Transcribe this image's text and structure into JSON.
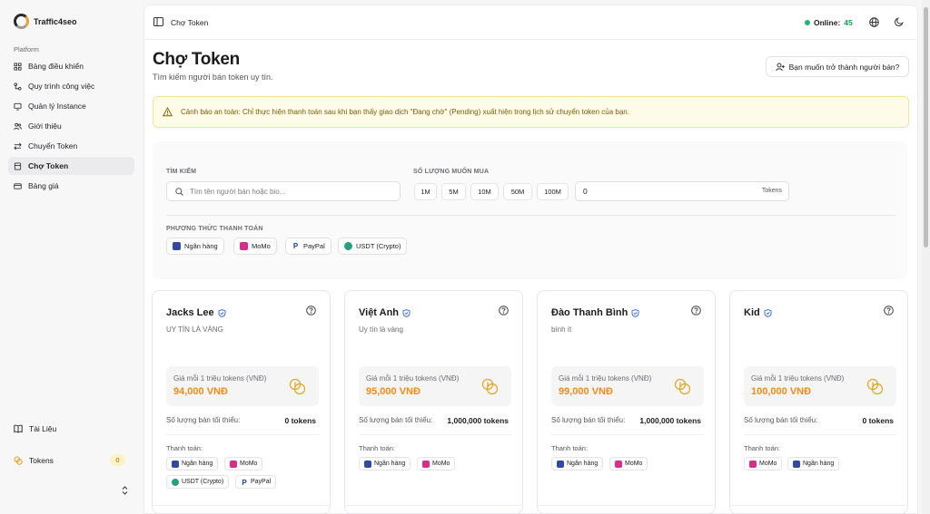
{
  "app": {
    "brand": "Traffic4seo"
  },
  "sidebar": {
    "group_label": "Platform",
    "items": [
      {
        "label": "Bảng điều khiển",
        "icon": "dashboard-icon"
      },
      {
        "label": "Quy trình công việc",
        "icon": "workflow-icon"
      },
      {
        "label": "Quản lý Instance",
        "icon": "monitor-icon"
      },
      {
        "label": "Giới thiệu",
        "icon": "users-icon"
      },
      {
        "label": "Chuyển Token",
        "icon": "transfer-icon"
      },
      {
        "label": "Chợ Token",
        "icon": "market-icon",
        "active": true
      },
      {
        "label": "Bảng giá",
        "icon": "card-icon"
      }
    ],
    "docs_label": "Tài Liệu",
    "tokens_label": "Tokens",
    "tokens_count": "0"
  },
  "topbar": {
    "breadcrumb": "Chợ Token",
    "online_label": "Online:",
    "online_count": "45"
  },
  "page": {
    "title": "Chợ Token",
    "subtitle": "Tìm kiếm người bán token uy tín.",
    "seller_button": "Bạn muốn trở thành người bán?"
  },
  "alert": {
    "text": "Cảnh báo an toàn: Chỉ thực hiện thanh toán sau khi bạn thấy giao dịch \"Đang chờ\" (Pending) xuất hiện trong lịch sử chuyển token của bạn."
  },
  "filters": {
    "search_label": "TÌM KIẾM",
    "search_placeholder": "Tìm tên người bán hoặc bio...",
    "quantity_label": "SỐ LƯỢNG MUỐN MUA",
    "quantity_options": [
      "1M",
      "5M",
      "10M",
      "50M",
      "100M"
    ],
    "quantity_value": "0",
    "quantity_unit": "Tokens",
    "payment_label": "PHƯƠNG THỨC THANH TOÁN",
    "payment_methods": [
      "Ngân hàng",
      "MoMo",
      "PayPal",
      "USDT (Crypto)"
    ]
  },
  "card_labels": {
    "price_label": "Giá mỗi 1 triệu tokens (VNĐ)",
    "min_label": "Số lượng bán tối thiểu:",
    "payment_title": "Thanh toán:"
  },
  "sellers": [
    {
      "name": "Jacks Lee",
      "bio": "UY TÍN LÀ VÀNG",
      "price": "94,000 VNĐ",
      "min": "0 tokens",
      "payments": [
        "Ngân hàng",
        "MoMo",
        "USDT (Crypto)",
        "PayPal"
      ]
    },
    {
      "name": "Việt Anh",
      "bio": "Uy tín là vàng",
      "price": "95,000 VNĐ",
      "min": "1,000,000 tokens",
      "payments": [
        "Ngân hàng",
        "MoMo"
      ]
    },
    {
      "name": "Đào Thanh Bình",
      "bio": "bình ít",
      "price": "99,000 VNĐ",
      "min": "1,000,000 tokens",
      "payments": [
        "Ngân hàng",
        "MoMo"
      ]
    },
    {
      "name": "Kid",
      "bio": "",
      "price": "100,000 VNĐ",
      "min": "0 tokens",
      "payments": [
        "MoMo",
        "Ngân hàng"
      ]
    }
  ],
  "colors": {
    "accent_price": "#f08a19",
    "online_dot": "#21b66b",
    "alert_bg": "#fefce8"
  }
}
